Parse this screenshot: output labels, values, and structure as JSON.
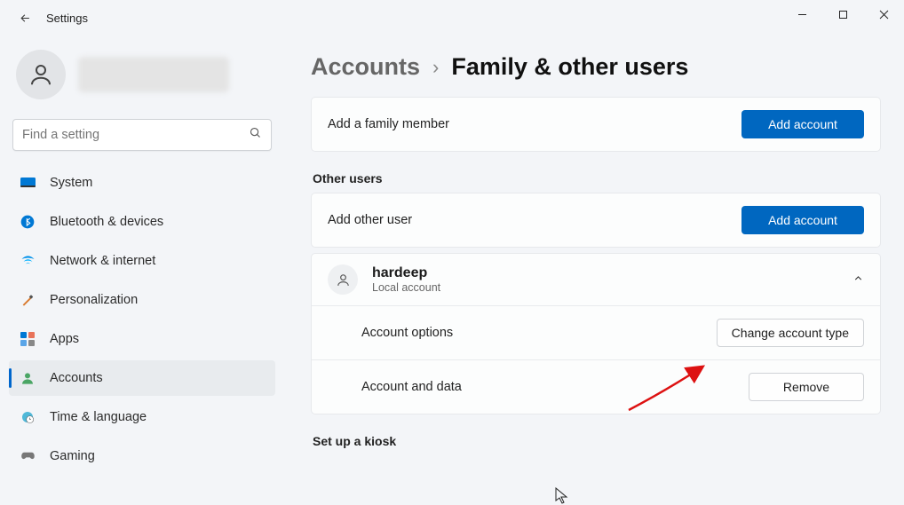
{
  "window": {
    "title": "Settings"
  },
  "search": {
    "placeholder": "Find a setting"
  },
  "sidebar": {
    "items": [
      {
        "label": "System"
      },
      {
        "label": "Bluetooth & devices"
      },
      {
        "label": "Network & internet"
      },
      {
        "label": "Personalization"
      },
      {
        "label": "Apps"
      },
      {
        "label": "Accounts"
      },
      {
        "label": "Time & language"
      },
      {
        "label": "Gaming"
      }
    ]
  },
  "breadcrumb": {
    "root": "Accounts",
    "page": "Family & other users"
  },
  "family": {
    "add_label": "Add a family member",
    "add_button": "Add account"
  },
  "other_users": {
    "section_label": "Other users",
    "add_label": "Add other user",
    "add_button": "Add account",
    "user": {
      "name": "hardeep",
      "type": "Local account"
    },
    "options_label": "Account options",
    "change_button": "Change account type",
    "data_label": "Account and data",
    "remove_button": "Remove"
  },
  "kiosk": {
    "section_label": "Set up a kiosk"
  }
}
